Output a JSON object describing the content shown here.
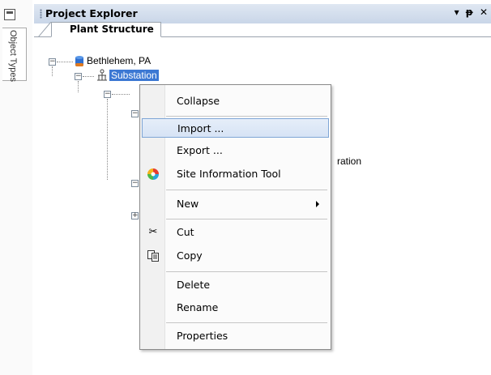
{
  "side_panel": {
    "tab_label": "Object Types"
  },
  "explorer": {
    "title": "Project Explorer",
    "title_buttons": {
      "dropdown": "▾",
      "pin": "ᵽ",
      "close": "✕"
    },
    "tab_label": "Plant Structure",
    "tree": {
      "root_label": "Bethlehem, PA",
      "child_label": "Substation",
      "partial_text": "ration"
    }
  },
  "context_menu": {
    "items": [
      {
        "label": "Collapse"
      },
      {
        "label": "Import ..."
      },
      {
        "label": "Export ..."
      },
      {
        "label": "Site Information Tool"
      },
      {
        "label": "New"
      },
      {
        "label": "Cut"
      },
      {
        "label": "Copy"
      },
      {
        "label": "Delete"
      },
      {
        "label": "Rename"
      },
      {
        "label": "Properties"
      }
    ],
    "hovered_item": "Import ..."
  }
}
